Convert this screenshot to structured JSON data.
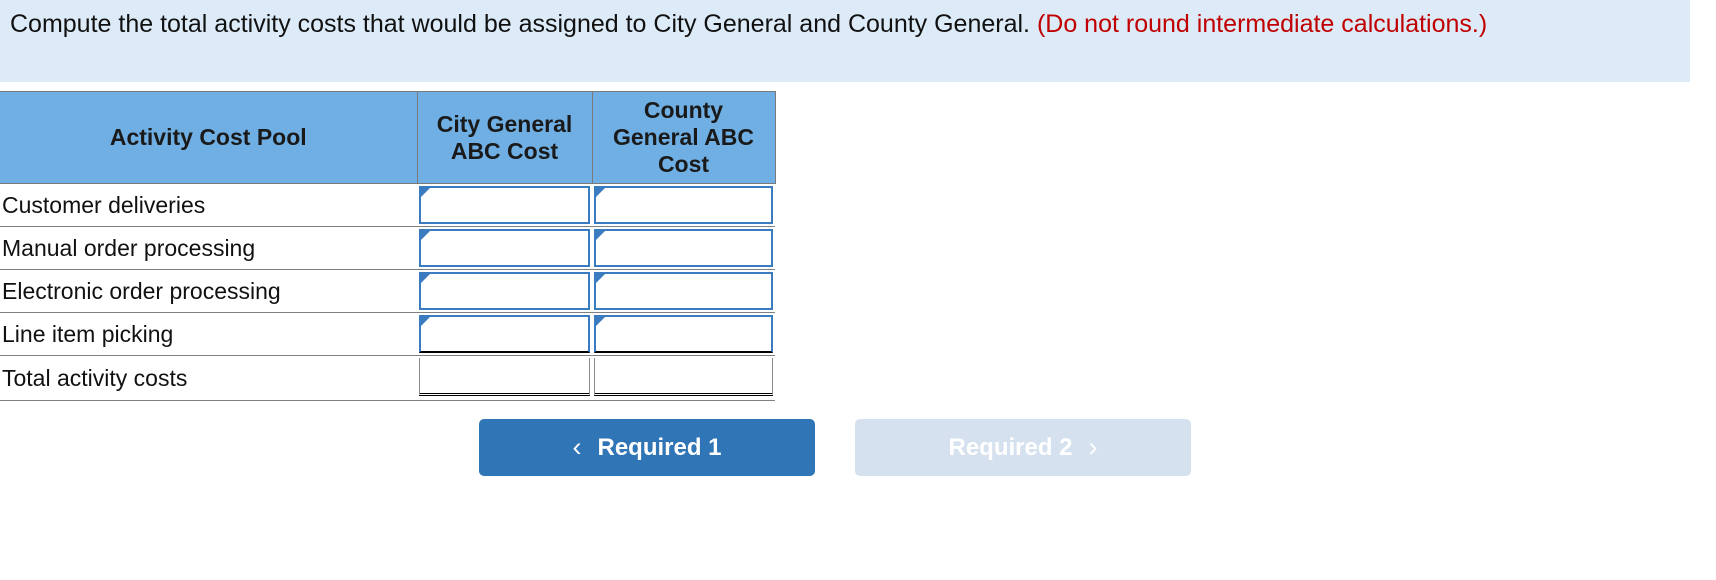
{
  "question": {
    "main_text": "Compute the total activity costs that would be assigned to City General and County General.",
    "note_text": "(Do not round intermediate calculations.)",
    "banner_color": "#dcebf7",
    "note_color": "#c00000"
  },
  "table": {
    "header_color": "#6fafe4",
    "columns": [
      {
        "key": "activity",
        "label": "Activity Cost Pool"
      },
      {
        "key": "city",
        "label": "City General ABC Cost"
      },
      {
        "key": "county",
        "label": "County General ABC Cost"
      }
    ],
    "rows": [
      {
        "label": "Customer deliveries",
        "city_value": "",
        "county_value": "",
        "type": "input"
      },
      {
        "label": "Manual order processing",
        "city_value": "",
        "county_value": "",
        "type": "input"
      },
      {
        "label": "Electronic order processing",
        "city_value": "",
        "county_value": "",
        "type": "input"
      },
      {
        "label": "Line item picking",
        "city_value": "",
        "county_value": "",
        "type": "input"
      }
    ],
    "total_row": {
      "label": "Total activity costs",
      "city_value": "",
      "county_value": "",
      "type": "total"
    },
    "input_border_color": "#3a7cbf"
  },
  "navigation": {
    "prev": {
      "label": "Required 1",
      "chevron": "chevron-left-icon",
      "glyph": "‹",
      "state": "active",
      "color": "#3075b5"
    },
    "next": {
      "label": "Required 2",
      "chevron": "chevron-right-icon",
      "glyph": "›",
      "state": "inactive",
      "color": "#d6e1ef"
    }
  }
}
